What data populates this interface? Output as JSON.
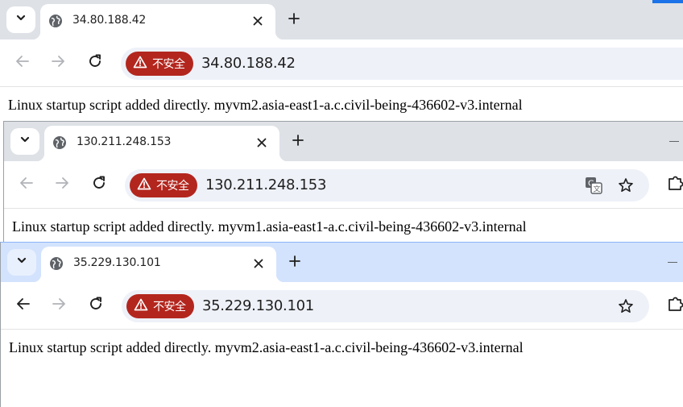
{
  "windows": [
    {
      "tab_title": "34.80.188.42",
      "security_label": "不安全",
      "url": "34.80.188.42",
      "page_text": "Linux startup script added directly. myvm2.asia-east1-a.c.civil-being-436602-v3.internal"
    },
    {
      "tab_title": "130.211.248.153",
      "security_label": "不安全",
      "url": "130.211.248.153",
      "page_text": "Linux startup script added directly. myvm1.asia-east1-a.c.civil-being-436602-v3.internal"
    },
    {
      "tab_title": "35.229.130.101",
      "security_label": "不安全",
      "url": "35.229.130.101",
      "page_text": "Linux startup script added directly. myvm2.asia-east1-a.c.civil-being-436602-v3.internal"
    }
  ],
  "icons": {
    "tab_list": "chevron-down-icon",
    "tab_favicon": "globe-icon",
    "tab_close": "close-icon",
    "new_tab": "plus-icon",
    "back": "arrow-left-icon",
    "forward": "arrow-right-icon",
    "reload": "reload-icon",
    "security": "warning-triangle-icon",
    "translate": "translate-icon",
    "bookmark": "star-icon",
    "extensions": "puzzle-icon",
    "minimize": "minimize-icon"
  },
  "colors": {
    "tabstrip_inactive": "#dee1e6",
    "tabstrip_active": "#d3e3fd",
    "security_chip": "#b3261e",
    "omnibox": "#eef1f8",
    "focus_accent": "#1a73e8"
  }
}
